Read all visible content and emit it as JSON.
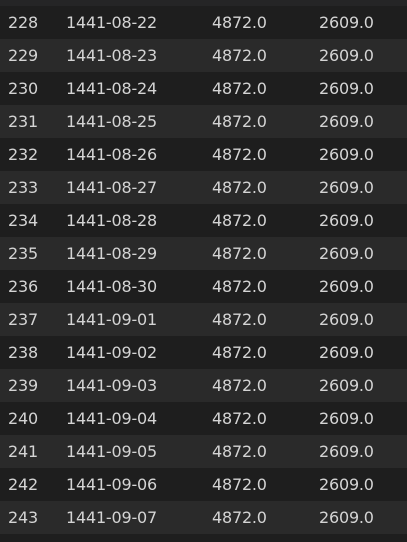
{
  "rows": [
    {
      "index": "228",
      "date": "1441-08-22",
      "v1": "4872.0",
      "v2": "2609.0"
    },
    {
      "index": "229",
      "date": "1441-08-23",
      "v1": "4872.0",
      "v2": "2609.0"
    },
    {
      "index": "230",
      "date": "1441-08-24",
      "v1": "4872.0",
      "v2": "2609.0"
    },
    {
      "index": "231",
      "date": "1441-08-25",
      "v1": "4872.0",
      "v2": "2609.0"
    },
    {
      "index": "232",
      "date": "1441-08-26",
      "v1": "4872.0",
      "v2": "2609.0"
    },
    {
      "index": "233",
      "date": "1441-08-27",
      "v1": "4872.0",
      "v2": "2609.0"
    },
    {
      "index": "234",
      "date": "1441-08-28",
      "v1": "4872.0",
      "v2": "2609.0"
    },
    {
      "index": "235",
      "date": "1441-08-29",
      "v1": "4872.0",
      "v2": "2609.0"
    },
    {
      "index": "236",
      "date": "1441-08-30",
      "v1": "4872.0",
      "v2": "2609.0"
    },
    {
      "index": "237",
      "date": "1441-09-01",
      "v1": "4872.0",
      "v2": "2609.0"
    },
    {
      "index": "238",
      "date": "1441-09-02",
      "v1": "4872.0",
      "v2": "2609.0"
    },
    {
      "index": "239",
      "date": "1441-09-03",
      "v1": "4872.0",
      "v2": "2609.0"
    },
    {
      "index": "240",
      "date": "1441-09-04",
      "v1": "4872.0",
      "v2": "2609.0"
    },
    {
      "index": "241",
      "date": "1441-09-05",
      "v1": "4872.0",
      "v2": "2609.0"
    },
    {
      "index": "242",
      "date": "1441-09-06",
      "v1": "4872.0",
      "v2": "2609.0"
    },
    {
      "index": "243",
      "date": "1441-09-07",
      "v1": "4872.0",
      "v2": "2609.0"
    }
  ],
  "colors": {
    "background": "#1e1e1e",
    "row_alt": "#2a2a2a",
    "text": "#d4d4d4"
  }
}
